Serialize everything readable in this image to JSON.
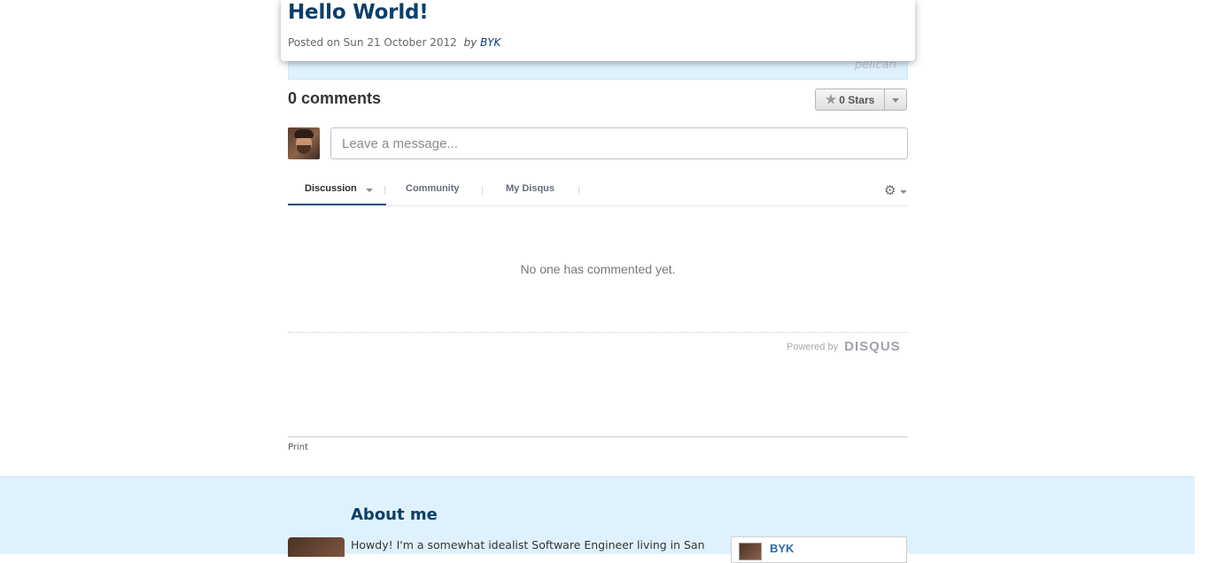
{
  "post": {
    "title": "Hello World!",
    "posted_prefix": "Posted on Sun 21 October 2012",
    "by_label": "by",
    "author": "BYK",
    "tag": "pelican"
  },
  "disqus": {
    "comments_count": "0 comments",
    "stars_label": "0 Stars",
    "message_placeholder": "Leave a message...",
    "tabs": [
      {
        "label": "Discussion",
        "active": true
      },
      {
        "label": "Community",
        "active": false
      },
      {
        "label": "My Disqus",
        "active": false
      }
    ],
    "empty_text": "No one has commented yet.",
    "powered_by": "Powered by",
    "brand": "DISQUS"
  },
  "footer_links": {
    "print": "Print"
  },
  "about": {
    "title": "About me",
    "text": "Howdy! I'm a somewhat idealist Software Engineer living in San",
    "profile_name": "BYK"
  },
  "colors": {
    "title_blue": "#0b3e6b",
    "footer_bg": "#dff1fd",
    "link_blue": "#2b6aa6"
  },
  "icons": [
    "star-icon",
    "chevron-down-icon",
    "gear-icon",
    "avatar"
  ]
}
